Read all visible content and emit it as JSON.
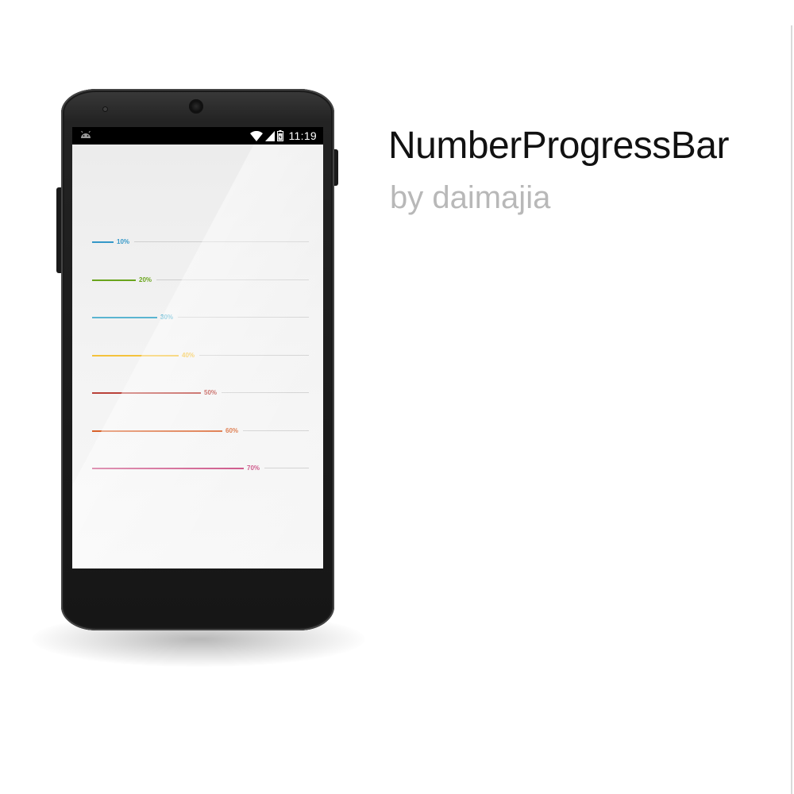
{
  "headline": {
    "title": "NumberProgressBar",
    "author": "by daimajia"
  },
  "status_bar": {
    "time": "11:19",
    "icons": [
      "android-icon",
      "wifi-icon",
      "signal-icon",
      "battery-icon"
    ]
  },
  "progress_bars": [
    {
      "label": "10%",
      "progress": 0.1,
      "color": "#3498c8"
    },
    {
      "label": "20%",
      "progress": 0.2,
      "color": "#6aa51d"
    },
    {
      "label": "30%",
      "progress": 0.3,
      "color": "#5bb5d1"
    },
    {
      "label": "40%",
      "progress": 0.4,
      "color": "#f4c23c"
    },
    {
      "label": "50%",
      "progress": 0.5,
      "color": "#b9413a"
    },
    {
      "label": "60%",
      "progress": 0.6,
      "color": "#d8612a"
    },
    {
      "label": "70%",
      "progress": 0.7,
      "color": "#c8447c"
    }
  ],
  "colors": {
    "track": "#cfcfcf",
    "title": "#111111",
    "author": "#b8b8b8"
  }
}
